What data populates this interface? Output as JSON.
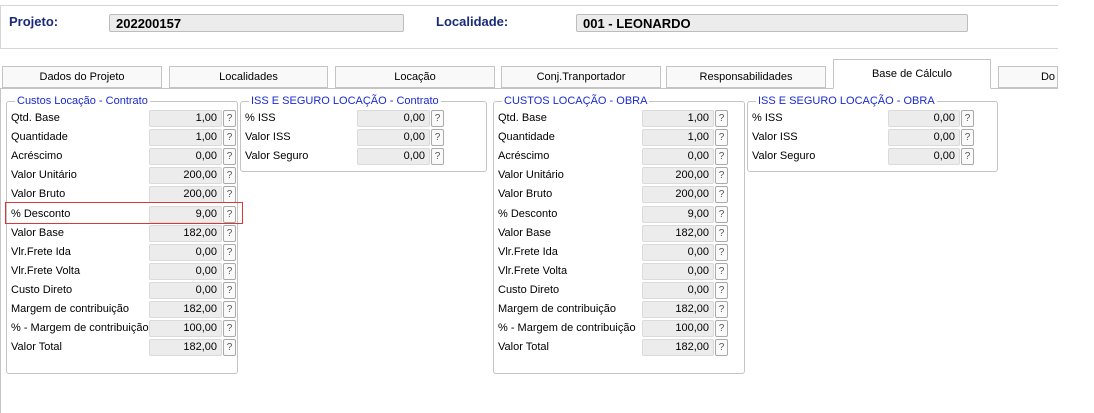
{
  "header": {
    "projeto_label": "Projeto:",
    "projeto_value": "202200157",
    "localidade_label": "Localidade:",
    "localidade_value": "001 - LEONARDO"
  },
  "tabs": [
    {
      "label": "Dados do Projeto",
      "active": false
    },
    {
      "label": "Localidades",
      "active": false
    },
    {
      "label": "Locação",
      "active": false
    },
    {
      "label": "Conj.Tranportador",
      "active": false
    },
    {
      "label": "Responsabilidades",
      "active": false
    },
    {
      "label": "Base de Cálculo",
      "active": true
    },
    {
      "label": "Do",
      "active": false
    }
  ],
  "help_symbol": "?",
  "groups": {
    "custos_contrato": {
      "title": "Custos Locação - Contrato",
      "rows": [
        {
          "label": "Qtd. Base",
          "value": "1,00"
        },
        {
          "label": "Quantidade",
          "value": "1,00"
        },
        {
          "label": "Acréscimo",
          "value": "0,00"
        },
        {
          "label": "Valor Unitário",
          "value": "200,00"
        },
        {
          "label": "Valor Bruto",
          "value": "200,00"
        },
        {
          "label": "% Desconto",
          "value": "9,00",
          "highlighted": true
        },
        {
          "label": "Valor Base",
          "value": "182,00"
        },
        {
          "label": "Vlr.Frete Ida",
          "value": "0,00"
        },
        {
          "label": "Vlr.Frete Volta",
          "value": "0,00"
        },
        {
          "label": "Custo Direto",
          "value": "0,00"
        },
        {
          "label": "Margem de contribuição",
          "value": "182,00"
        },
        {
          "label": "% - Margem de contribuição",
          "value": "100,00"
        },
        {
          "label": "Valor Total",
          "value": "182,00"
        }
      ]
    },
    "iss_contrato": {
      "title": "ISS E SEGURO LOCAÇÃO - Contrato",
      "rows": [
        {
          "label": "% ISS",
          "value": "0,00"
        },
        {
          "label": "Valor ISS",
          "value": "0,00"
        },
        {
          "label": "Valor Seguro",
          "value": "0,00"
        }
      ]
    },
    "custos_obra": {
      "title": "CUSTOS LOCAÇÃO - OBRA",
      "rows": [
        {
          "label": "Qtd. Base",
          "value": "1,00"
        },
        {
          "label": "Quantidade",
          "value": "1,00"
        },
        {
          "label": "Acréscimo",
          "value": "0,00"
        },
        {
          "label": "Valor Unitário",
          "value": "200,00"
        },
        {
          "label": "Valor Bruto",
          "value": "200,00"
        },
        {
          "label": "% Desconto",
          "value": "9,00"
        },
        {
          "label": "Valor Base",
          "value": "182,00"
        },
        {
          "label": "Vlr.Frete Ida",
          "value": "0,00"
        },
        {
          "label": "Vlr.Frete Volta",
          "value": "0,00"
        },
        {
          "label": "Custo Direto",
          "value": "0,00"
        },
        {
          "label": "Margem de contribuição",
          "value": "182,00"
        },
        {
          "label": "% - Margem de contribuição",
          "value": "100,00"
        },
        {
          "label": "Valor Total",
          "value": "182,00"
        }
      ]
    },
    "iss_obra": {
      "title": "ISS E SEGURO LOCAÇÃO - OBRA",
      "rows": [
        {
          "label": "% ISS",
          "value": "0,00"
        },
        {
          "label": "Valor ISS",
          "value": "0,00"
        },
        {
          "label": "Valor Seguro",
          "value": "0,00"
        }
      ]
    }
  },
  "colors": {
    "header_label": "#1a2a78",
    "group_title": "#1a2acc",
    "highlight_border": "#d43a3a",
    "field_bg": "#ececec"
  }
}
